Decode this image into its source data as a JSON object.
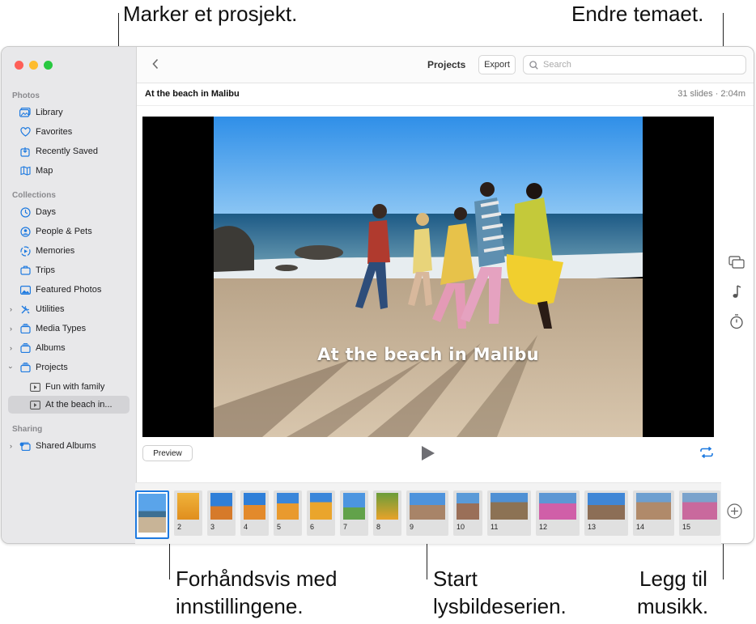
{
  "callouts": {
    "select_project": "Marker et prosjekt.",
    "change_theme": "Endre temaet.",
    "preview_line1": "Forhåndsvis med",
    "preview_line2": "innstillingene.",
    "play_line1": "Start",
    "play_line2": "lysbildeserien.",
    "music_line1": "Legg til",
    "music_line2": "musikk."
  },
  "sidebar": {
    "photos_header": "Photos",
    "photos_items": [
      {
        "label": "Library",
        "icon": "library-icon"
      },
      {
        "label": "Favorites",
        "icon": "heart-icon"
      },
      {
        "label": "Recently Saved",
        "icon": "recently-saved-icon"
      },
      {
        "label": "Map",
        "icon": "map-icon"
      }
    ],
    "collections_header": "Collections",
    "collections_items": [
      {
        "label": "Days",
        "icon": "clock-icon"
      },
      {
        "label": "People & Pets",
        "icon": "person-icon"
      },
      {
        "label": "Memories",
        "icon": "memories-icon"
      },
      {
        "label": "Trips",
        "icon": "suitcase-icon"
      },
      {
        "label": "Featured Photos",
        "icon": "photo-icon"
      },
      {
        "label": "Utilities",
        "icon": "tools-icon"
      },
      {
        "label": "Media Types",
        "icon": "stack-icon"
      },
      {
        "label": "Albums",
        "icon": "stack-icon"
      },
      {
        "label": "Projects",
        "icon": "stack-icon"
      },
      {
        "label": "Fun with family",
        "icon": "slideshow-icon"
      },
      {
        "label": "At the beach in...",
        "icon": "slideshow-icon"
      }
    ],
    "sharing_header": "Sharing",
    "sharing_items": [
      {
        "label": "Shared Albums",
        "icon": "shared-album-icon"
      }
    ]
  },
  "toolbar": {
    "title": "Projects",
    "export_label": "Export",
    "search_placeholder": "Search"
  },
  "project": {
    "title": "At the beach in Malibu",
    "meta": "31 slides · 2:04m",
    "slide_caption": "At the beach in Malibu"
  },
  "controls": {
    "preview_label": "Preview"
  },
  "slides": [
    "2",
    "3",
    "4",
    "5",
    "6",
    "7",
    "8",
    "9",
    "10",
    "11",
    "12",
    "13",
    "14",
    "15"
  ],
  "colors": {
    "accent": "#1e7ae0",
    "sidebar_bg": "#e8e8ea"
  }
}
